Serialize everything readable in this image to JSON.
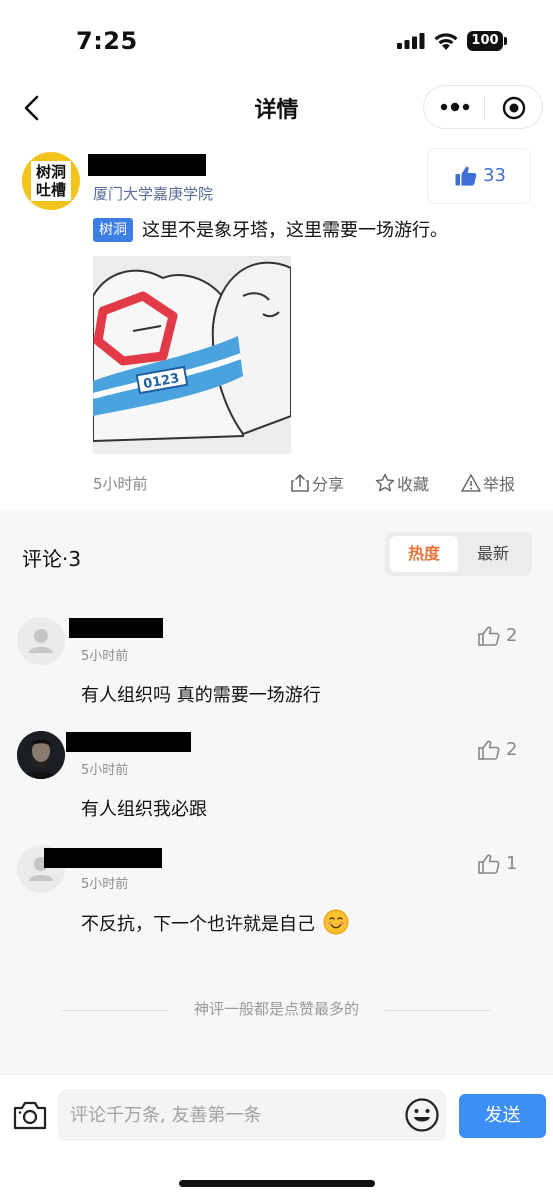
{
  "status_bar": {
    "time": "7:25",
    "battery": "100"
  },
  "nav": {
    "title": "详情"
  },
  "post": {
    "college": "厦门大学嘉庚学院",
    "avatar_text": [
      "树洞",
      "吐槽"
    ],
    "like_count": "33",
    "tag": "树洞",
    "text": "这里不是象牙塔，这里需要一场游行。",
    "image_text": "0123",
    "time": "5小时前",
    "actions": {
      "share": "分享",
      "collect": "收藏",
      "report": "举报"
    }
  },
  "comments": {
    "title": "评论·3",
    "sort": {
      "hot": "热度",
      "new": "最新"
    },
    "items": [
      {
        "time": "5小时前",
        "likes": "2",
        "text": "有人组织吗 真的需要一场游行"
      },
      {
        "time": "5小时前",
        "likes": "2",
        "text": "有人组织我必跟"
      },
      {
        "time": "5小时前",
        "likes": "1",
        "text": "不反抗，下一个也许就是自己"
      }
    ],
    "footer": "神评一般都是点赞最多的"
  },
  "input_bar": {
    "placeholder": "评论千万条, 友善第一条",
    "send": "发送"
  },
  "colors": {
    "accent": "#3d8ef5",
    "hot": "#e5753c",
    "link": "#5a6c98"
  }
}
